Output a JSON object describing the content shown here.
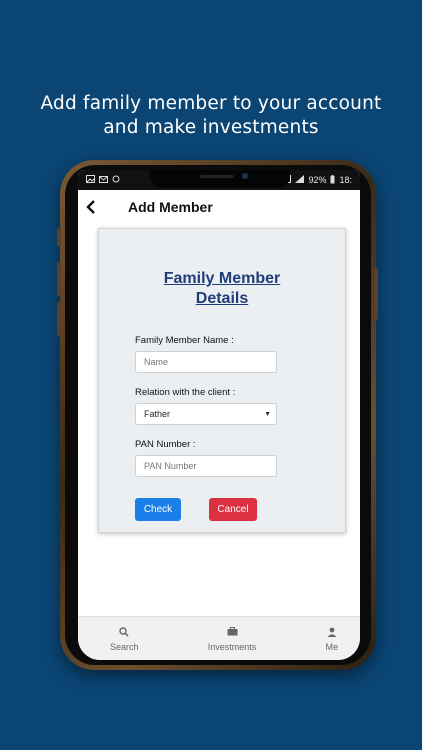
{
  "promo": {
    "line1": "Add family member to your account",
    "line2": "and make investments"
  },
  "statusbar": {
    "left_icons": [
      "image-icon",
      "mail-icon",
      "sync-icon"
    ],
    "battery": "92%",
    "time": "18:"
  },
  "appbar": {
    "title": "Add Member",
    "back_icon": "chevron-left-icon"
  },
  "form": {
    "title_line1": "Family Member",
    "title_line2": "Details",
    "name_label": "Family Member Name :",
    "name_placeholder": "Name",
    "relation_label": "Relation with the client :",
    "relation_value": "Father",
    "pan_label": "PAN Number :",
    "pan_placeholder": "PAN Number",
    "check_label": "Check",
    "cancel_label": "Cancel"
  },
  "bottom_nav": [
    {
      "label": "Search",
      "icon": "search-icon"
    },
    {
      "label": "Investments",
      "icon": "briefcase-icon"
    },
    {
      "label": "Me",
      "icon": "user-icon"
    }
  ],
  "colors": {
    "background": "#0a4574",
    "title_link": "#1f3d7a",
    "check_button": "#1a7fe8",
    "cancel_button": "#dc3142"
  }
}
